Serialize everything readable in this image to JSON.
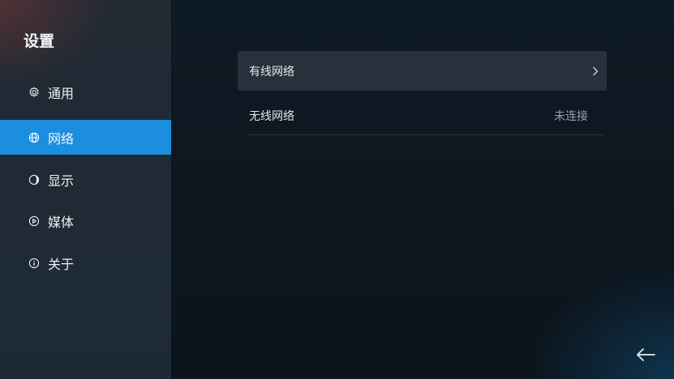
{
  "sidebar": {
    "title": "设置",
    "items": [
      {
        "label": "通用",
        "icon": "gear-icon"
      },
      {
        "label": "网络",
        "icon": "globe-icon",
        "active": true
      },
      {
        "label": "显示",
        "icon": "display-icon"
      },
      {
        "label": "媒体",
        "icon": "play-icon"
      },
      {
        "label": "关于",
        "icon": "info-icon"
      }
    ]
  },
  "main": {
    "rows": [
      {
        "label": "有线网络",
        "icon": "chevron-right-icon"
      },
      {
        "label": "无线网络",
        "status": "未连接"
      }
    ]
  },
  "footer": {
    "back_icon": "back-arrow-icon"
  },
  "colors": {
    "accent": "#1c8ee0"
  }
}
